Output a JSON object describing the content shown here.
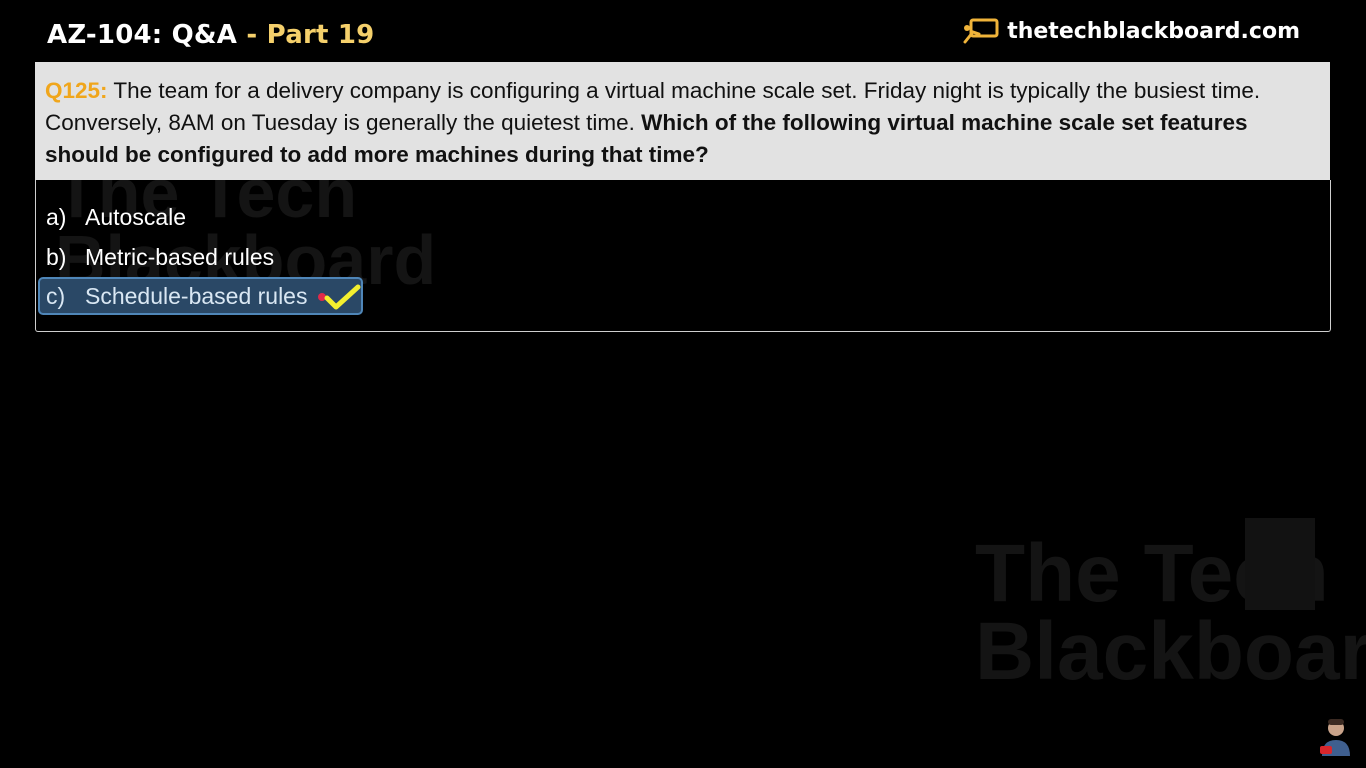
{
  "header": {
    "title": "AZ-104: Q&A",
    "separator": "-",
    "part": "Part 19",
    "brand": "thetechblackboard.com"
  },
  "question": {
    "number": "Q125:",
    "text": "The team for a delivery company is configuring a virtual machine scale set. Friday night is typically the busiest time. Conversely, 8AM on Tuesday is generally the quietest time.",
    "bold_text": "Which of the following virtual machine scale set features should be configured to add more machines during that time?"
  },
  "options": [
    {
      "letter": "a)",
      "label": "Autoscale"
    },
    {
      "letter": "b)",
      "label": "Metric-based rules"
    },
    {
      "letter": "c)",
      "label": "Schedule-based rules"
    }
  ],
  "watermark": {
    "line1": "The Tech",
    "line2": "Blackboard"
  },
  "colors": {
    "accent": "#f0a61c",
    "part_color": "#f5d06b",
    "selected_bg": "#2a4866",
    "selected_border": "#4f86b8",
    "check": "#f3ef2f"
  },
  "icons": {
    "brand": "chalkboard-icon",
    "check": "checkmark-icon",
    "avatar": "presenter-avatar"
  }
}
